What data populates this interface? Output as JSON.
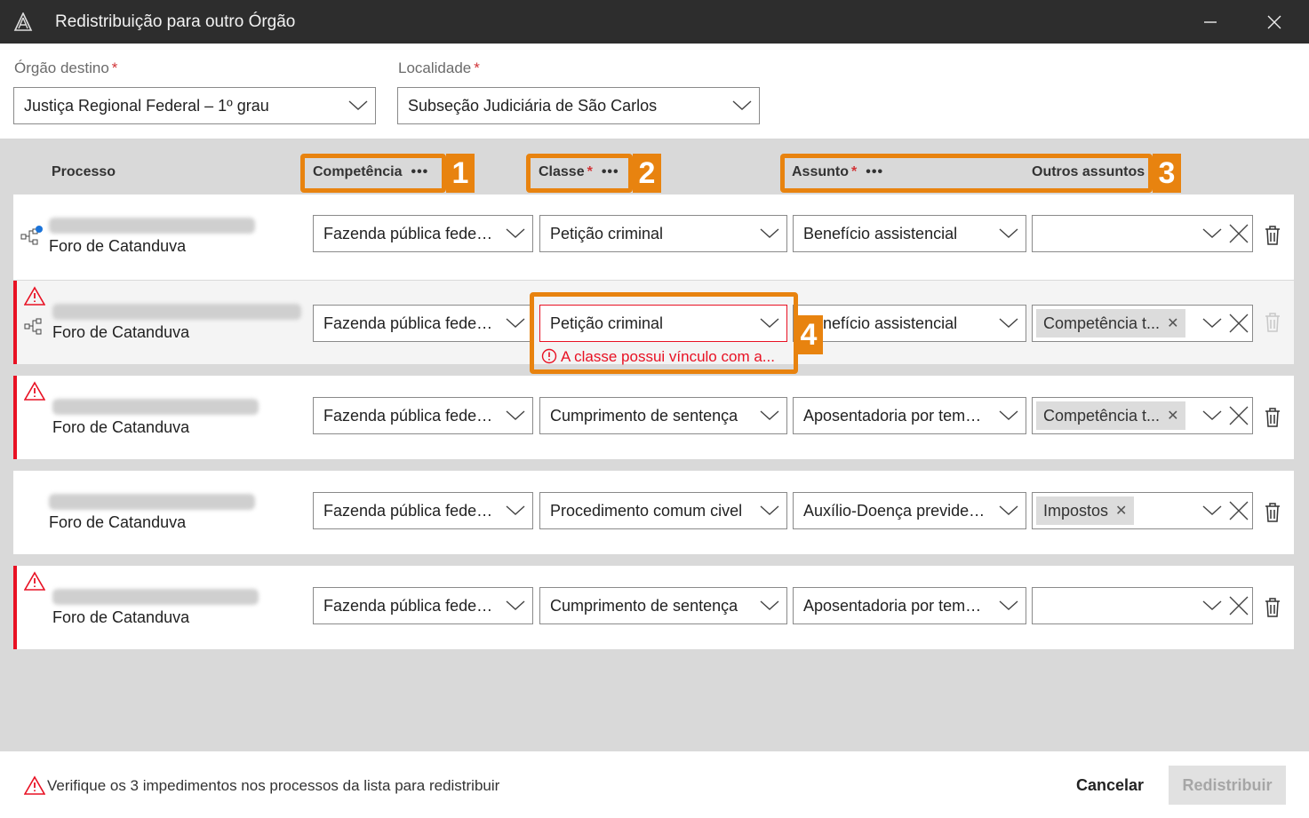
{
  "window": {
    "title": "Redistribuição para outro Órgão"
  },
  "destination": {
    "orgao_label": "Órgão destino",
    "orgao_value": "Justiça Regional Federal – 1º grau",
    "localidade_label": "Localidade",
    "localidade_value": "Subseção Judiciária de São Carlos",
    "required_mark": "*"
  },
  "columns": {
    "processo": "Processo",
    "competencia": "Competência",
    "classe": "Classe",
    "assunto": "Assunto",
    "outros": "Outros assuntos",
    "more": "•••"
  },
  "callouts": [
    "1",
    "2",
    "3",
    "4"
  ],
  "rows": [
    {
      "foro": "Foro de Catanduva",
      "competencia": "Fazenda pública federal",
      "classe": "Petição criminal",
      "assunto": "Benefício assistencial",
      "chip": ""
    },
    {
      "foro": "Foro de Catanduva",
      "competencia": "Fazenda pública federal",
      "classe": "Petição criminal",
      "assunto": "Benefício assistencial",
      "chip": "Competência t...",
      "error": "A classe possui vínculo com a..."
    },
    {
      "foro": "Foro de Catanduva",
      "competencia": "Fazenda pública federal",
      "classe": "Cumprimento de sentença",
      "assunto": "Aposentadoria por temp...",
      "chip": "Competência t..."
    },
    {
      "foro": "Foro de Catanduva",
      "competencia": "Fazenda pública federal",
      "classe": "Procedimento comum civel",
      "assunto": "Auxílio-Doença previden...",
      "chip": "Impostos"
    },
    {
      "foro": "Foro de Catanduva",
      "competencia": "Fazenda pública federal",
      "classe": "Cumprimento de sentença",
      "assunto": "Aposentadoria por temp...",
      "chip": ""
    }
  ],
  "footer": {
    "warning": "Verifique os 3 impedimentos nos processos da lista para redistribuir",
    "cancel": "Cancelar",
    "submit": "Redistribuir"
  },
  "colors": {
    "accent_callout": "#e8830f",
    "error": "#e81123",
    "titlebar": "#2d2d2d"
  }
}
